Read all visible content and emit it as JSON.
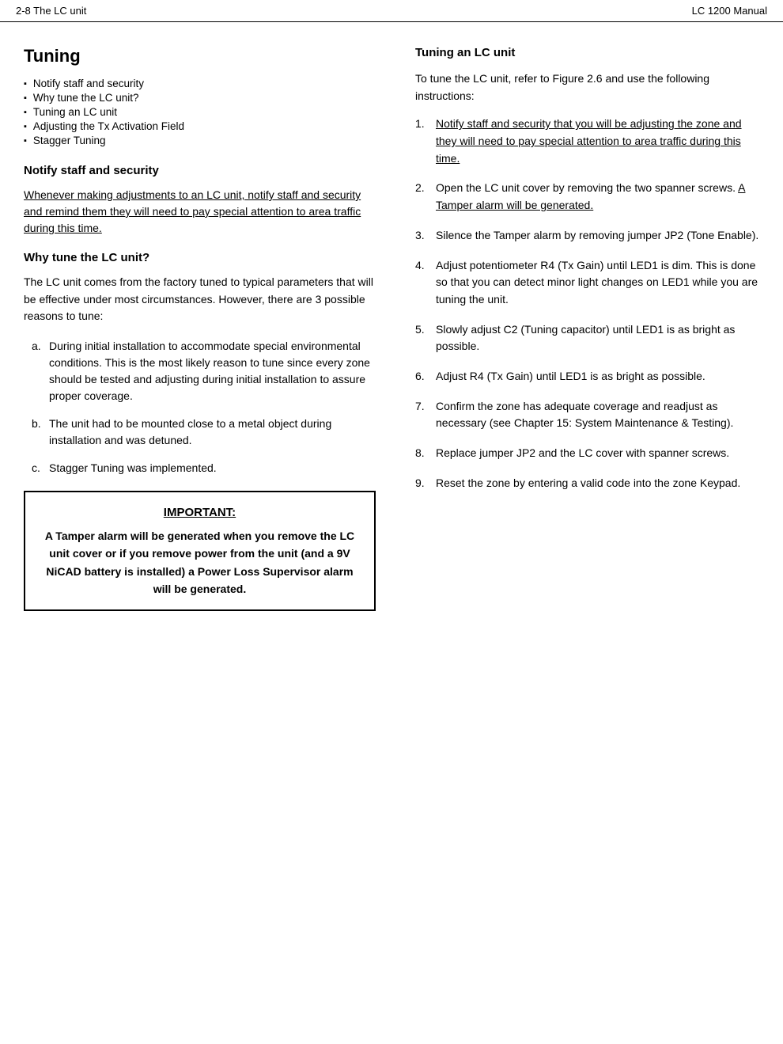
{
  "header": {
    "left": "2-8 The LC unit",
    "right": "LC 1200 Manual"
  },
  "left": {
    "title": "Tuning",
    "toc": [
      "Notify staff and security",
      "Why tune the LC unit?",
      "Tuning an LC unit",
      "Adjusting the Tx Activation Field",
      "Stagger Tuning"
    ],
    "section1": {
      "heading": "Notify staff and security",
      "underline_para": "Whenever making adjustments to an LC unit, notify staff and security and remind them they will need to pay special attention to area traffic during this time."
    },
    "section2": {
      "heading": "Why tune the LC unit?",
      "body": "The LC unit comes from the factory tuned to typical parameters that will be effective under most circumstances. However, there are 3 possible reasons to tune:",
      "sub_items": [
        {
          "label": "a.",
          "text": "During initial installation to accommodate special environmental conditions. This is the most likely reason to tune since every zone should be tested and adjusting during initial installation to assure proper coverage."
        },
        {
          "label": "b.",
          "text": "The unit had to be mounted close to a metal object during installation and was detuned."
        },
        {
          "label": "c.",
          "text": "Stagger Tuning was implemented."
        }
      ]
    },
    "important": {
      "title": "IMPORTANT:",
      "body": "A Tamper alarm will be generated when you remove the LC unit cover or if you remove power from the unit (and a 9V NiCAD battery is installed) a Power Loss Supervisor alarm will be generated."
    }
  },
  "right": {
    "heading": "Tuning an LC unit",
    "intro": "To tune the LC unit, refer to Figure 2.6 and use the following instructions:",
    "steps": [
      {
        "num": "1.",
        "text": "Notify staff and security that you will be adjusting the zone and they will need to pay special attention to area traffic during this time.",
        "underline": true
      },
      {
        "num": "2.",
        "text": "Open the LC unit cover by removing the two spanner screws.",
        "underline_part": "A Tamper alarm will be generated.",
        "underline": false
      },
      {
        "num": "3.",
        "text": "Silence the Tamper alarm by removing jumper JP2 (Tone Enable).",
        "underline": false
      },
      {
        "num": "4.",
        "text": "Adjust potentiometer R4 (Tx Gain) until LED1 is dim. This is done so that you can detect minor light changes on LED1 while you are tuning the unit.",
        "underline": false
      },
      {
        "num": "5.",
        "text": "Slowly adjust C2 (Tuning capacitor) until LED1 is as bright as possible.",
        "underline": false
      },
      {
        "num": "6.",
        "text": "Adjust R4 (Tx Gain) until LED1 is as bright as possible.",
        "underline": false
      },
      {
        "num": "7.",
        "text": "Confirm the zone has adequate coverage and readjust as necessary (see Chapter 15: System Maintenance & Testing).",
        "underline": false
      },
      {
        "num": "8.",
        "text": "Replace jumper JP2 and the LC cover with spanner screws.",
        "underline": false
      },
      {
        "num": "9.",
        "text": "Reset the zone by entering a valid code into the zone Keypad.",
        "underline": false
      }
    ]
  }
}
